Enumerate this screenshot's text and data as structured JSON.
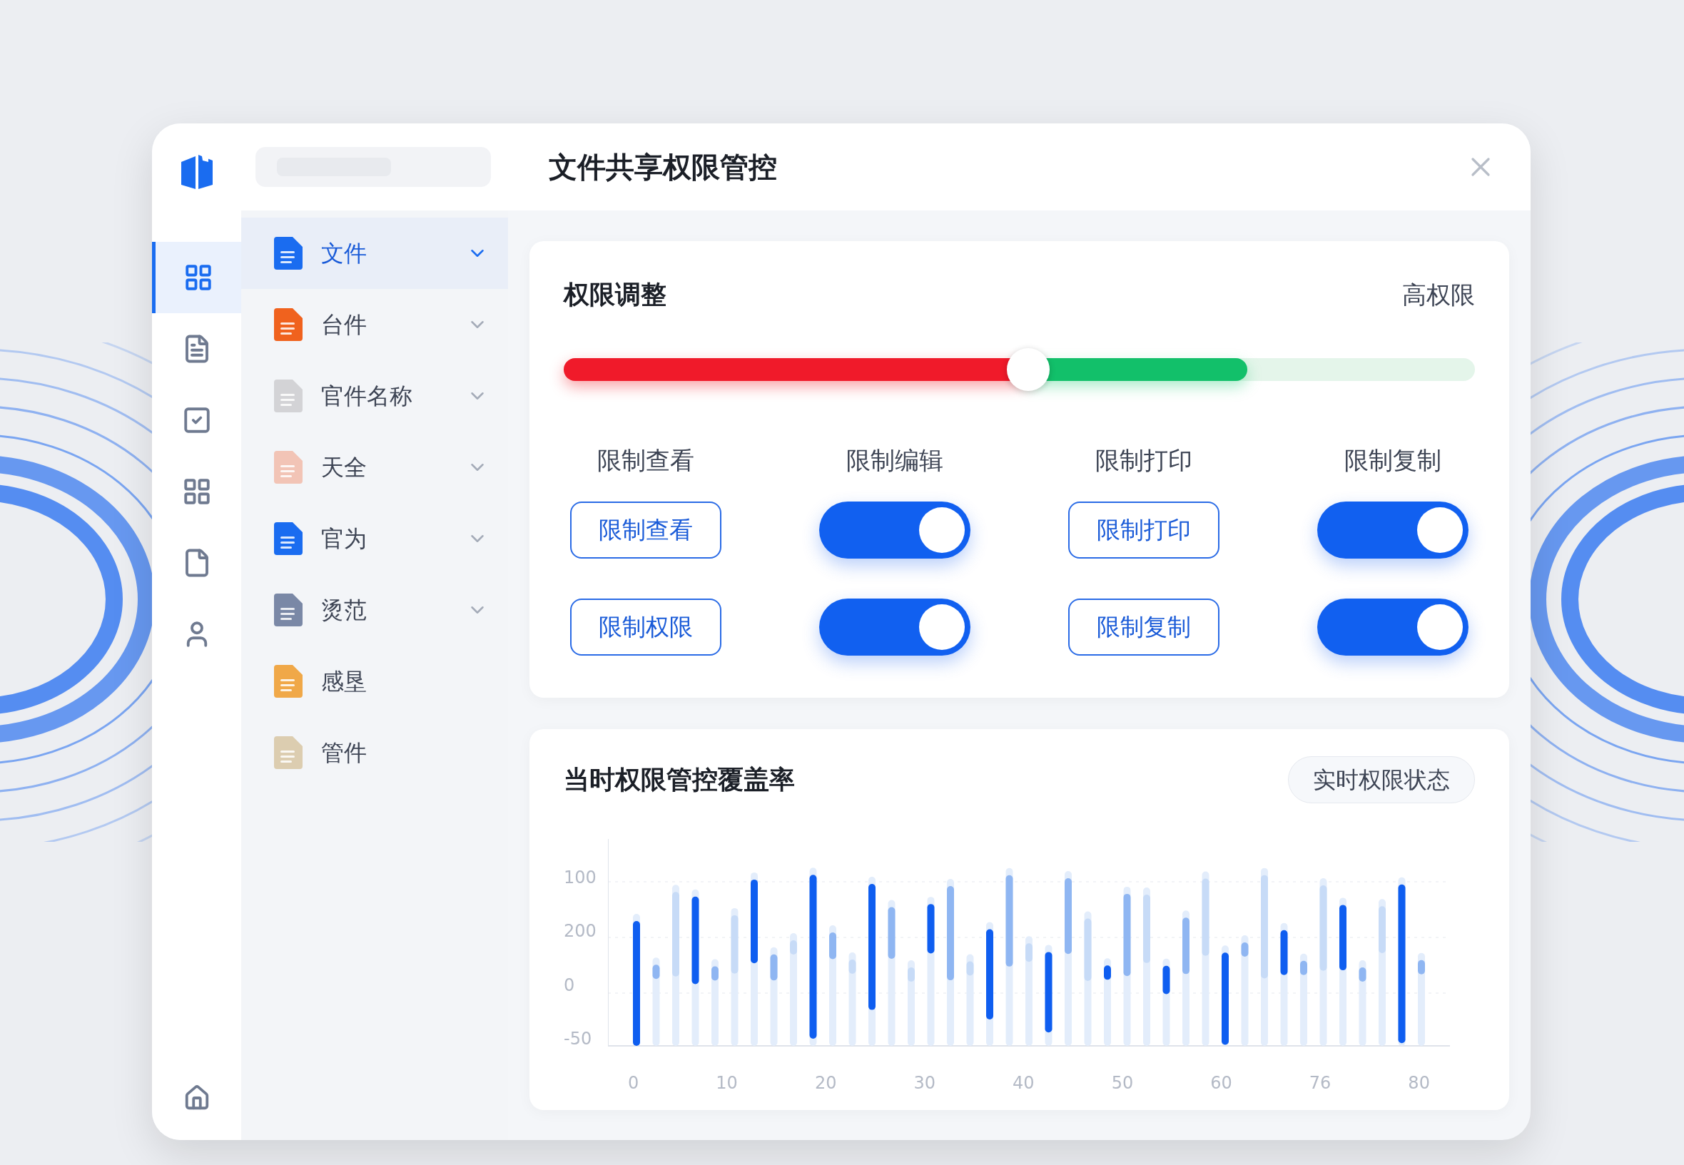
{
  "window": {
    "title": "文件共享权限管控"
  },
  "rail": [
    {
      "kind": "grid",
      "selected": true
    },
    {
      "kind": "file",
      "selected": false
    },
    {
      "kind": "check",
      "selected": false
    },
    {
      "kind": "grid",
      "selected": false
    },
    {
      "kind": "page",
      "selected": false
    },
    {
      "kind": "user",
      "selected": false
    }
  ],
  "nav": [
    {
      "label": "文件",
      "color": "#1a6cf0",
      "expandable": true,
      "selected": true
    },
    {
      "label": "台件",
      "color": "#f0621e",
      "expandable": true,
      "selected": false
    },
    {
      "label": "官件名称",
      "color": "#d3d3d6",
      "expandable": true,
      "selected": false
    },
    {
      "label": "天全",
      "color": "#f2c4b6",
      "expandable": true,
      "selected": false
    },
    {
      "label": "官为",
      "color": "#1a6cf0",
      "expandable": true,
      "selected": false
    },
    {
      "label": "烫范",
      "color": "#7a88a6",
      "expandable": true,
      "selected": false
    },
    {
      "label": "感垦",
      "color": "#f0a848",
      "expandable": false,
      "selected": false
    },
    {
      "label": "管件",
      "color": "#dccdb0",
      "expandable": false,
      "selected": false
    }
  ],
  "permissions": {
    "title": "权限调整",
    "level_label": "高权限",
    "level": 0.51,
    "columns": [
      "限制查看",
      "限制编辑",
      "限制打印",
      "限制复制"
    ],
    "rows": [
      [
        {
          "kind": "button",
          "label": "限制查看"
        },
        {
          "kind": "toggle",
          "on": true
        },
        {
          "kind": "button",
          "label": "限制打印"
        },
        {
          "kind": "toggle",
          "on": true
        }
      ],
      [
        {
          "kind": "button",
          "label": "限制权限"
        },
        {
          "kind": "toggle",
          "on": true
        },
        {
          "kind": "button",
          "label": "限制复制"
        },
        {
          "kind": "toggle",
          "on": true
        }
      ]
    ]
  },
  "coverage": {
    "title": "当时权限管控覆盖率",
    "badge": "实时权限状态",
    "y_labels": [
      "100",
      "200",
      "0",
      "-50"
    ],
    "x_labels": [
      "0",
      "10",
      "20",
      "30",
      "40",
      "50",
      "60",
      "76",
      "80"
    ]
  }
}
